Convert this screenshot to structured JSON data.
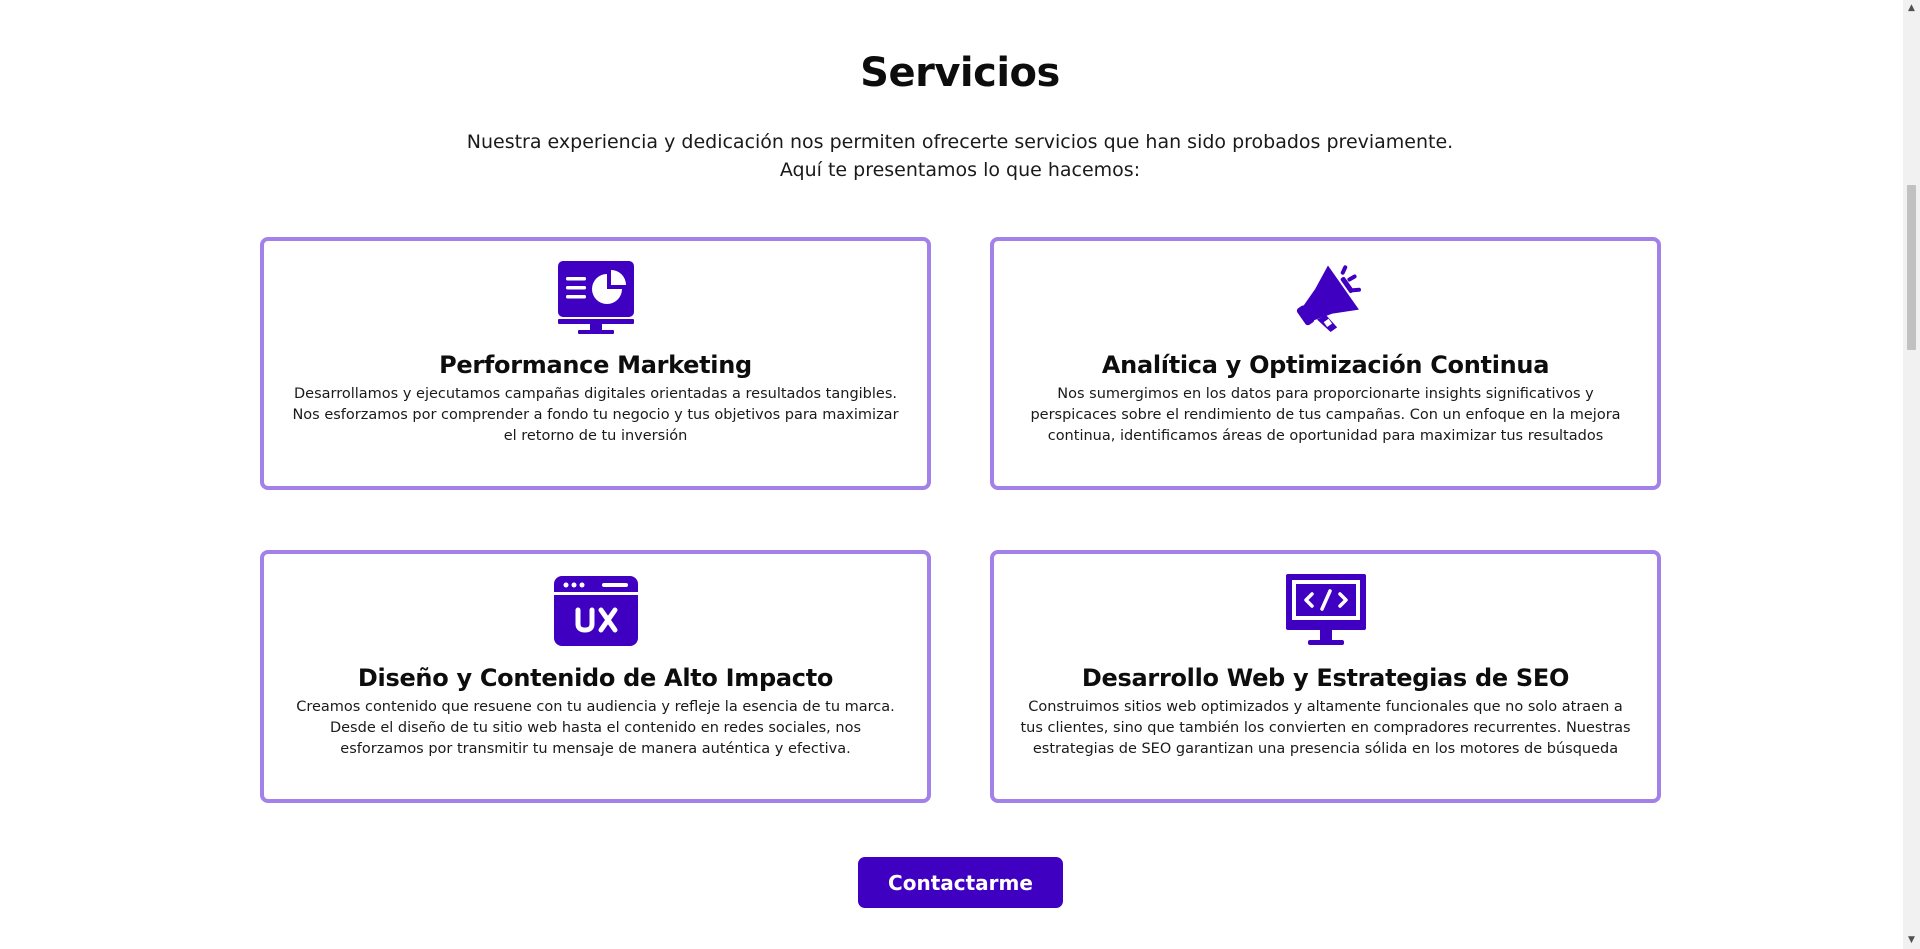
{
  "section": {
    "title": "Servicios",
    "intro_line1": "Nuestra experiencia y dedicación nos permiten ofrecerte servicios que han sido probados previamente.",
    "intro_line2": "Aquí te presentamos lo que hacemos:"
  },
  "services": [
    {
      "icon": "analytics-monitor-icon",
      "title": "Performance Marketing",
      "description": "Desarrollamos y ejecutamos campañas digitales orientadas a resultados tangibles. Nos esforzamos por comprender a fondo tu negocio y tus objetivos para maximizar el retorno de tu inversión"
    },
    {
      "icon": "megaphone-icon",
      "title": "Analítica y Optimización Continua",
      "description": "Nos sumergimos en los datos para proporcionarte insights significativos y perspicaces sobre el rendimiento de tus campañas. Con un enfoque en la mejora continua, identificamos áreas de oportunidad para maximizar tus resultados"
    },
    {
      "icon": "ux-window-icon",
      "title": "Diseño y Contenido de Alto Impacto",
      "description": "Creamos contenido que resuene con tu audiencia y refleje la esencia de tu marca. Desde el diseño de tu sitio web hasta el contenido en redes sociales, nos esforzamos por transmitir tu mensaje de manera auténtica y efectiva."
    },
    {
      "icon": "code-monitor-icon",
      "title": "Desarrollo Web y Estrategias de SEO",
      "description": "Construimos sitios web optimizados y altamente funcionales que no solo atraen a tus clientes, sino que también los convierten en compradores recurrentes. Nuestras estrategias de SEO garantizan una presencia sólida en los motores de búsqueda"
    }
  ],
  "cta": {
    "label": "Contactarme"
  },
  "colors": {
    "accent": "#3f00c2",
    "card_border": "#a281e8",
    "text": "#111111"
  }
}
